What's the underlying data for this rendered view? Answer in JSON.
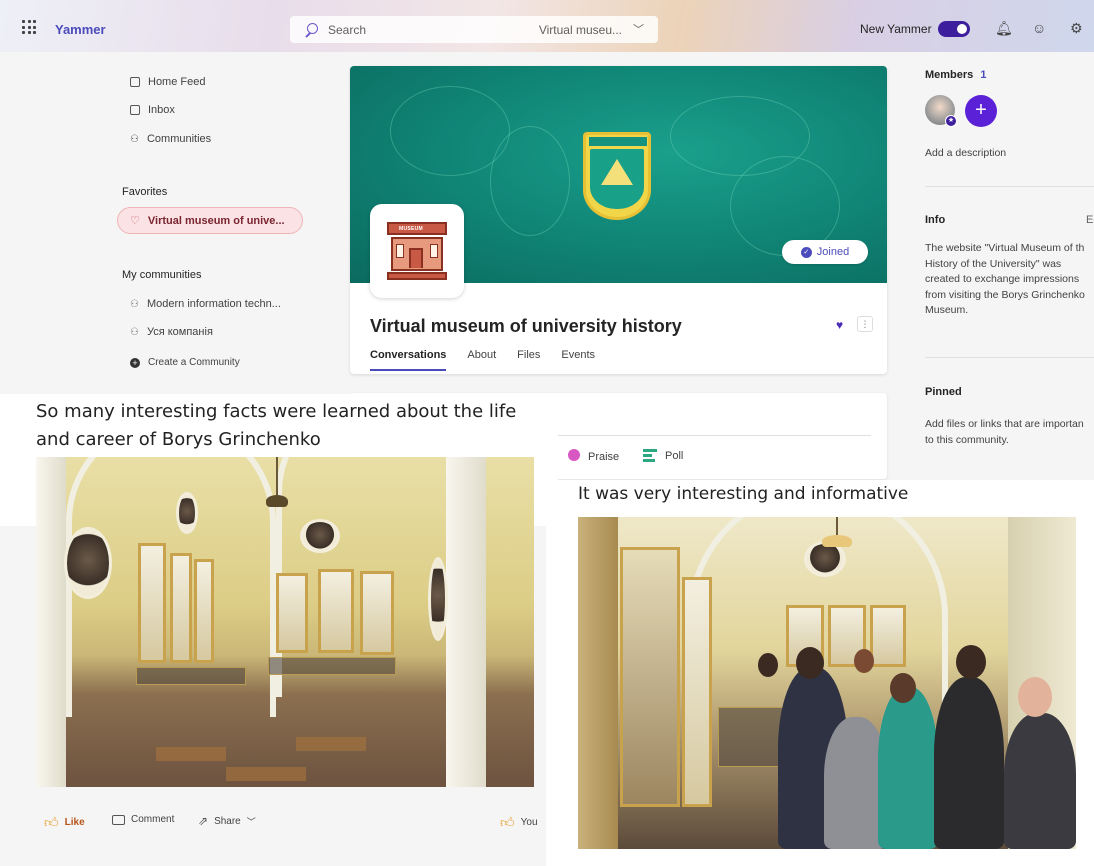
{
  "topbar": {
    "brand": "Yammer",
    "search_placeholder": "Search",
    "search_scope": "Virtual museu...",
    "new_yammer_label": "New Yammer",
    "new_yammer_on": true
  },
  "nav": {
    "items": [
      {
        "label": "Home Feed",
        "icon": "home-feed-icon"
      },
      {
        "label": "Inbox",
        "icon": "inbox-icon"
      },
      {
        "label": "Communities",
        "icon": "communities-icon"
      }
    ],
    "favorites_heading": "Favorites",
    "favorite_item": "Virtual museum of unive...",
    "my_communities_heading": "My communities",
    "communities": [
      {
        "label": "Modern information techn...",
        "icon": "community-icon"
      },
      {
        "label": "Уся компанія",
        "icon": "community-icon"
      }
    ],
    "create_label": "Create a Community"
  },
  "group": {
    "title": "Virtual museum of university history",
    "joined_label": "Joined",
    "logo_sign": "MUSEUM",
    "tabs": [
      "Conversations",
      "About",
      "Files",
      "Events"
    ],
    "active_tab": "Conversations"
  },
  "publisher": {
    "praise_label": "Praise",
    "poll_label": "Poll"
  },
  "right": {
    "members_heading": "Members",
    "members_count": "1",
    "add_description": "Add a description",
    "info_heading": "Info",
    "info_edit": "Ec",
    "info_text": "The website \"Virtual Museum of th\nHistory of the University\" was\ncreated to exchange impressions\nfrom visiting the Borys Grinchenko\nMuseum.",
    "pinned_heading": "Pinned",
    "pinned_text": "Add files or links that are importan\nto this community."
  },
  "overlay": {
    "caption1": "So many interesting facts were learned about the life and career of Borys Grinchenko",
    "caption2": "It was very interesting and informative"
  },
  "post_actions": {
    "like": "Like",
    "comment": "Comment",
    "share": "Share",
    "reaction_by": "You"
  },
  "colors": {
    "accent": "#4b4bbb",
    "banner": "#0f8274",
    "favorite_bg": "#fbe3e5"
  }
}
